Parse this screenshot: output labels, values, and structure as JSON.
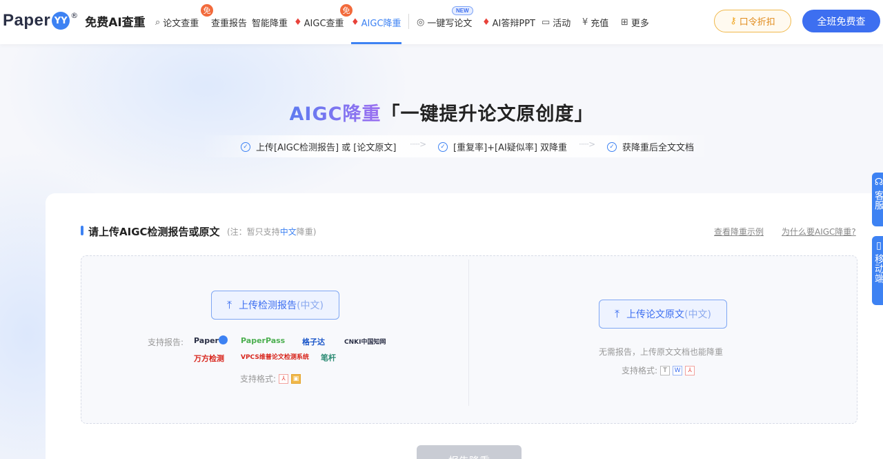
{
  "header": {
    "logo_text": "Paper",
    "logo_mark": "YY",
    "logo_reg": "®",
    "logo_slogan": "免费AI查重",
    "nav": [
      {
        "label": "论文查重",
        "icon": "search-doc-icon"
      },
      {
        "label": "查重报告",
        "badge": "免"
      },
      {
        "label": "智能降重"
      },
      {
        "label": "AIGC查重",
        "icon": "fire-icon",
        "badge": "免"
      },
      {
        "label": "AIGC降重",
        "icon": "fire-icon",
        "active": true
      },
      {
        "label": "一键写论文",
        "icon": "brain-icon",
        "badge": "NEW"
      },
      {
        "label": "AI答辩PPT",
        "icon": "fire-icon"
      },
      {
        "label": "活动",
        "icon": "gift-icon"
      },
      {
        "label": "充值",
        "icon": "yen-icon"
      },
      {
        "label": "更多",
        "icon": "grid-icon"
      }
    ],
    "kouling_label": "口令折扣",
    "free_button_label": "全班免费查"
  },
  "hero": {
    "title_highlight": "AIGC降重",
    "title_rest": "「一键提升论文原创度」",
    "steps": [
      "上传[AIGC检测报告] 或 [论文原文]",
      "[重复率]+[AI疑似率] 双降重",
      "获降重后全文文档"
    ],
    "arrow": "·····>"
  },
  "card": {
    "section_title": "请上传AIGC检测报告或原文",
    "note_prefix": "(注：暂只支持",
    "note_highlight": "中文",
    "note_suffix": "降重)",
    "link_example": "查看降重示例",
    "link_why": "为什么要AIGC降重?",
    "left": {
      "upload_label": "上传检测报告",
      "upload_lang": "(中文)",
      "support_reports_label": "支持报告:",
      "brands": [
        "Paper",
        "PaperPass",
        "格子达",
        "CNKI中国知网",
        "万方检测",
        "VPCS维普论文检测系统",
        "笔杆"
      ],
      "support_formats_label": "支持格式:",
      "formats": [
        "PDF",
        "IMG"
      ]
    },
    "right": {
      "upload_label": "上传论文原文",
      "upload_lang": "(中文)",
      "no_report_text": "无需报告，上传原文文档也能降重",
      "support_formats_label": "支持格式:",
      "formats": [
        "T",
        "W",
        "PDF"
      ]
    },
    "submit_label": "报告降重"
  },
  "side": {
    "service_label": "客服",
    "mobile_label": "移动端"
  },
  "colors": {
    "primary": "#3d82f3",
    "accent_orange": "#f26a3b",
    "fire": "#e8423a"
  }
}
